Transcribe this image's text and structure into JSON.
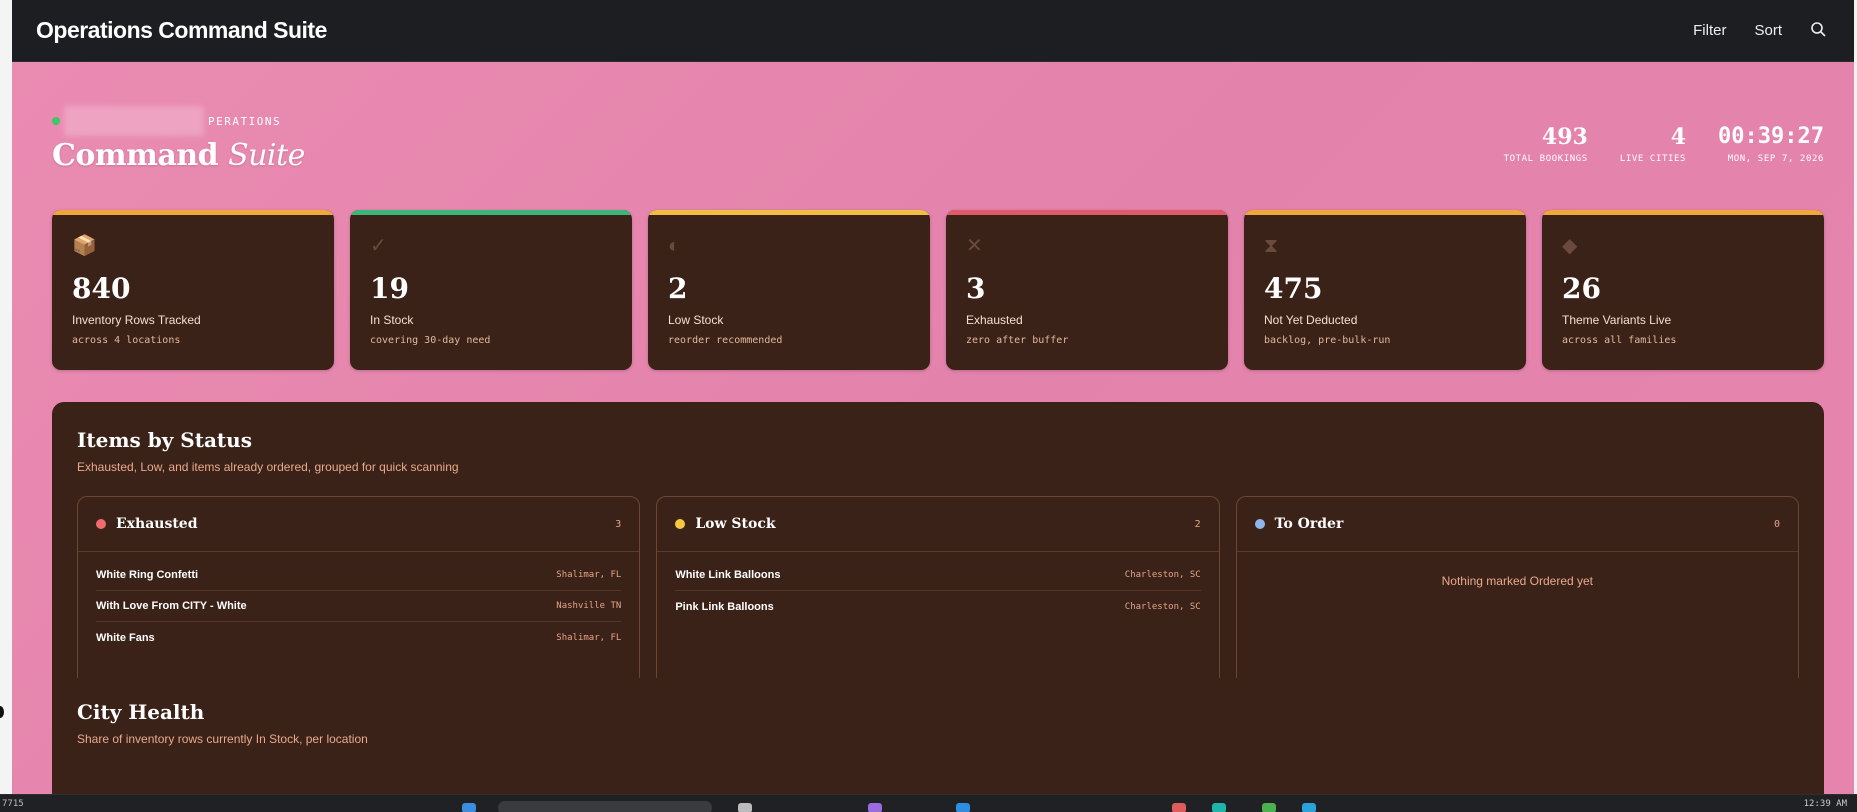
{
  "app": {
    "title": "Operations Command Suite"
  },
  "topbar": {
    "filter_label": "Filter",
    "sort_label": "Sort",
    "search_icon": "search-icon"
  },
  "hero": {
    "eyebrow": "PERATIONS",
    "title_main": "Command",
    "title_italic": "Suite",
    "stats": [
      {
        "value": "493",
        "caption": "TOTAL BOOKINGS"
      },
      {
        "value": "4",
        "caption": "LIVE CITIES"
      },
      {
        "value": "00:39:27",
        "caption": "MON, SEP 7, 2026"
      }
    ]
  },
  "cards": [
    {
      "icon": "📦",
      "icon_name": "package-icon",
      "value": "840",
      "title": "Inventory Rows Tracked",
      "sub": "across 4 locations",
      "accent": "#f0a83c"
    },
    {
      "icon": "✓",
      "icon_name": "check-icon",
      "value": "19",
      "title": "In Stock",
      "sub": "covering 30-day need",
      "accent": "#3bb57a"
    },
    {
      "icon": "◐",
      "icon_name": "half-circle-icon",
      "value": "2",
      "title": "Low Stock",
      "sub": "reorder recommended",
      "accent": "#f2bd45"
    },
    {
      "icon": "✕",
      "icon_name": "x-icon",
      "value": "3",
      "title": "Exhausted",
      "sub": "zero after buffer",
      "accent": "#e05b6a"
    },
    {
      "icon": "⧗",
      "icon_name": "hourglass-icon",
      "value": "475",
      "title": "Not Yet Deducted",
      "sub": "backlog, pre-bulk-run",
      "accent": "#f0a83c"
    },
    {
      "icon": "◆",
      "icon_name": "diamond-icon",
      "value": "26",
      "title": "Theme Variants Live",
      "sub": "across all families",
      "accent": "#f0a83c"
    }
  ],
  "status_panel": {
    "title": "Items by Status",
    "description": "Exhausted, Low, and items already ordered, grouped for quick scanning",
    "groups": [
      {
        "name": "Exhausted",
        "count": "3",
        "color": "#f06b6b",
        "items": [
          {
            "name": "White Ring Confetti",
            "location": "Shalimar, FL"
          },
          {
            "name": "With Love From CITY - White",
            "location": "Nashville TN"
          },
          {
            "name": "White Fans",
            "location": "Shalimar, FL"
          }
        ]
      },
      {
        "name": "Low Stock",
        "count": "2",
        "color": "#f5c842",
        "items": [
          {
            "name": "White Link Balloons",
            "location": "Charleston, SC"
          },
          {
            "name": "Pink Link Balloons",
            "location": "Charleston, SC"
          }
        ]
      },
      {
        "name": "To Order",
        "count": "0",
        "color": "#8fb8ea",
        "items": [],
        "empty_text": "Nothing marked Ordered yet"
      }
    ]
  },
  "city_panel": {
    "title": "City Health",
    "description": "Share of inventory rows currently In Stock, per location"
  },
  "taskbar": {
    "time_left": "7715",
    "time_right": "12:39 AM"
  }
}
